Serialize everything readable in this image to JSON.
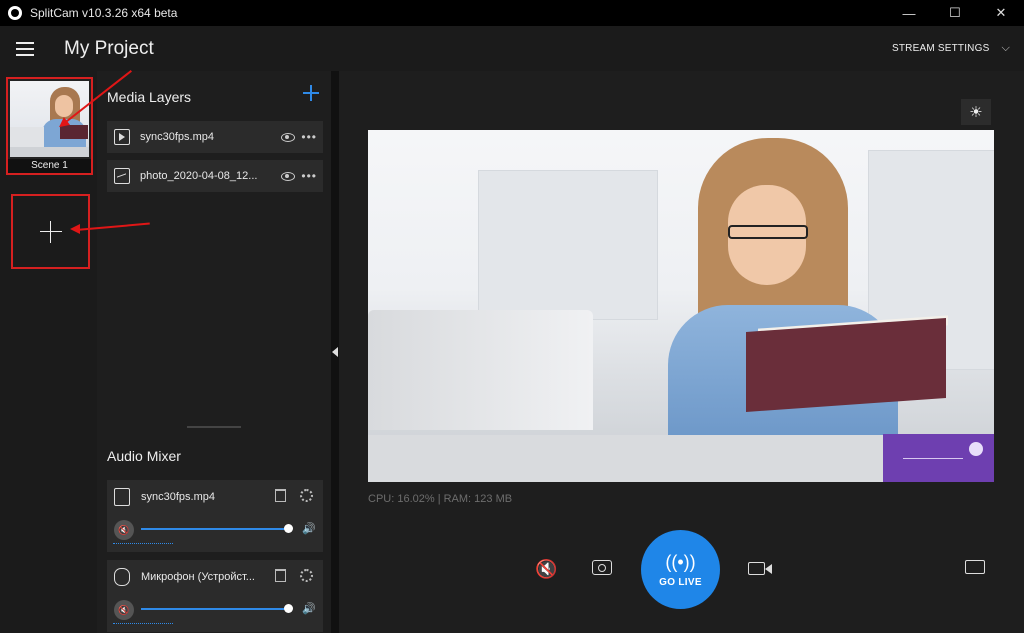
{
  "window": {
    "title": "SplitCam v10.3.26 x64 beta",
    "minimize": "—",
    "maximize": "☐",
    "close": "✕"
  },
  "header": {
    "project_title": "My Project",
    "stream_settings": "STREAM SETTINGS",
    "chevron": "⌵"
  },
  "scenes": {
    "items": [
      {
        "label": "Scene 1"
      }
    ],
    "add_label": ""
  },
  "media_layers": {
    "title": "Media Layers",
    "items": [
      {
        "name": "sync30fps.mp4",
        "icon": "video-file-icon"
      },
      {
        "name": "photo_2020-04-08_12...",
        "icon": "image-file-icon"
      }
    ],
    "more": "•••"
  },
  "audio_mixer": {
    "title": "Audio Mixer",
    "items": [
      {
        "name": "sync30fps.mp4",
        "volume": 1.0
      },
      {
        "name": "Микрофон (Устройст...",
        "volume": 1.0
      }
    ],
    "mute_glyph": "🔇",
    "vol_glyph": "🔊"
  },
  "preview": {
    "brightness_glyph": "☀",
    "cpu_text": "CPU: 16.02% | RAM: 123 MB"
  },
  "controls": {
    "mute_glyph": "🔇",
    "go_live_label": "GO LIVE",
    "go_live_glyph": "((•))"
  },
  "colors": {
    "accent": "#1f86e8",
    "annotation": "#e01616"
  }
}
